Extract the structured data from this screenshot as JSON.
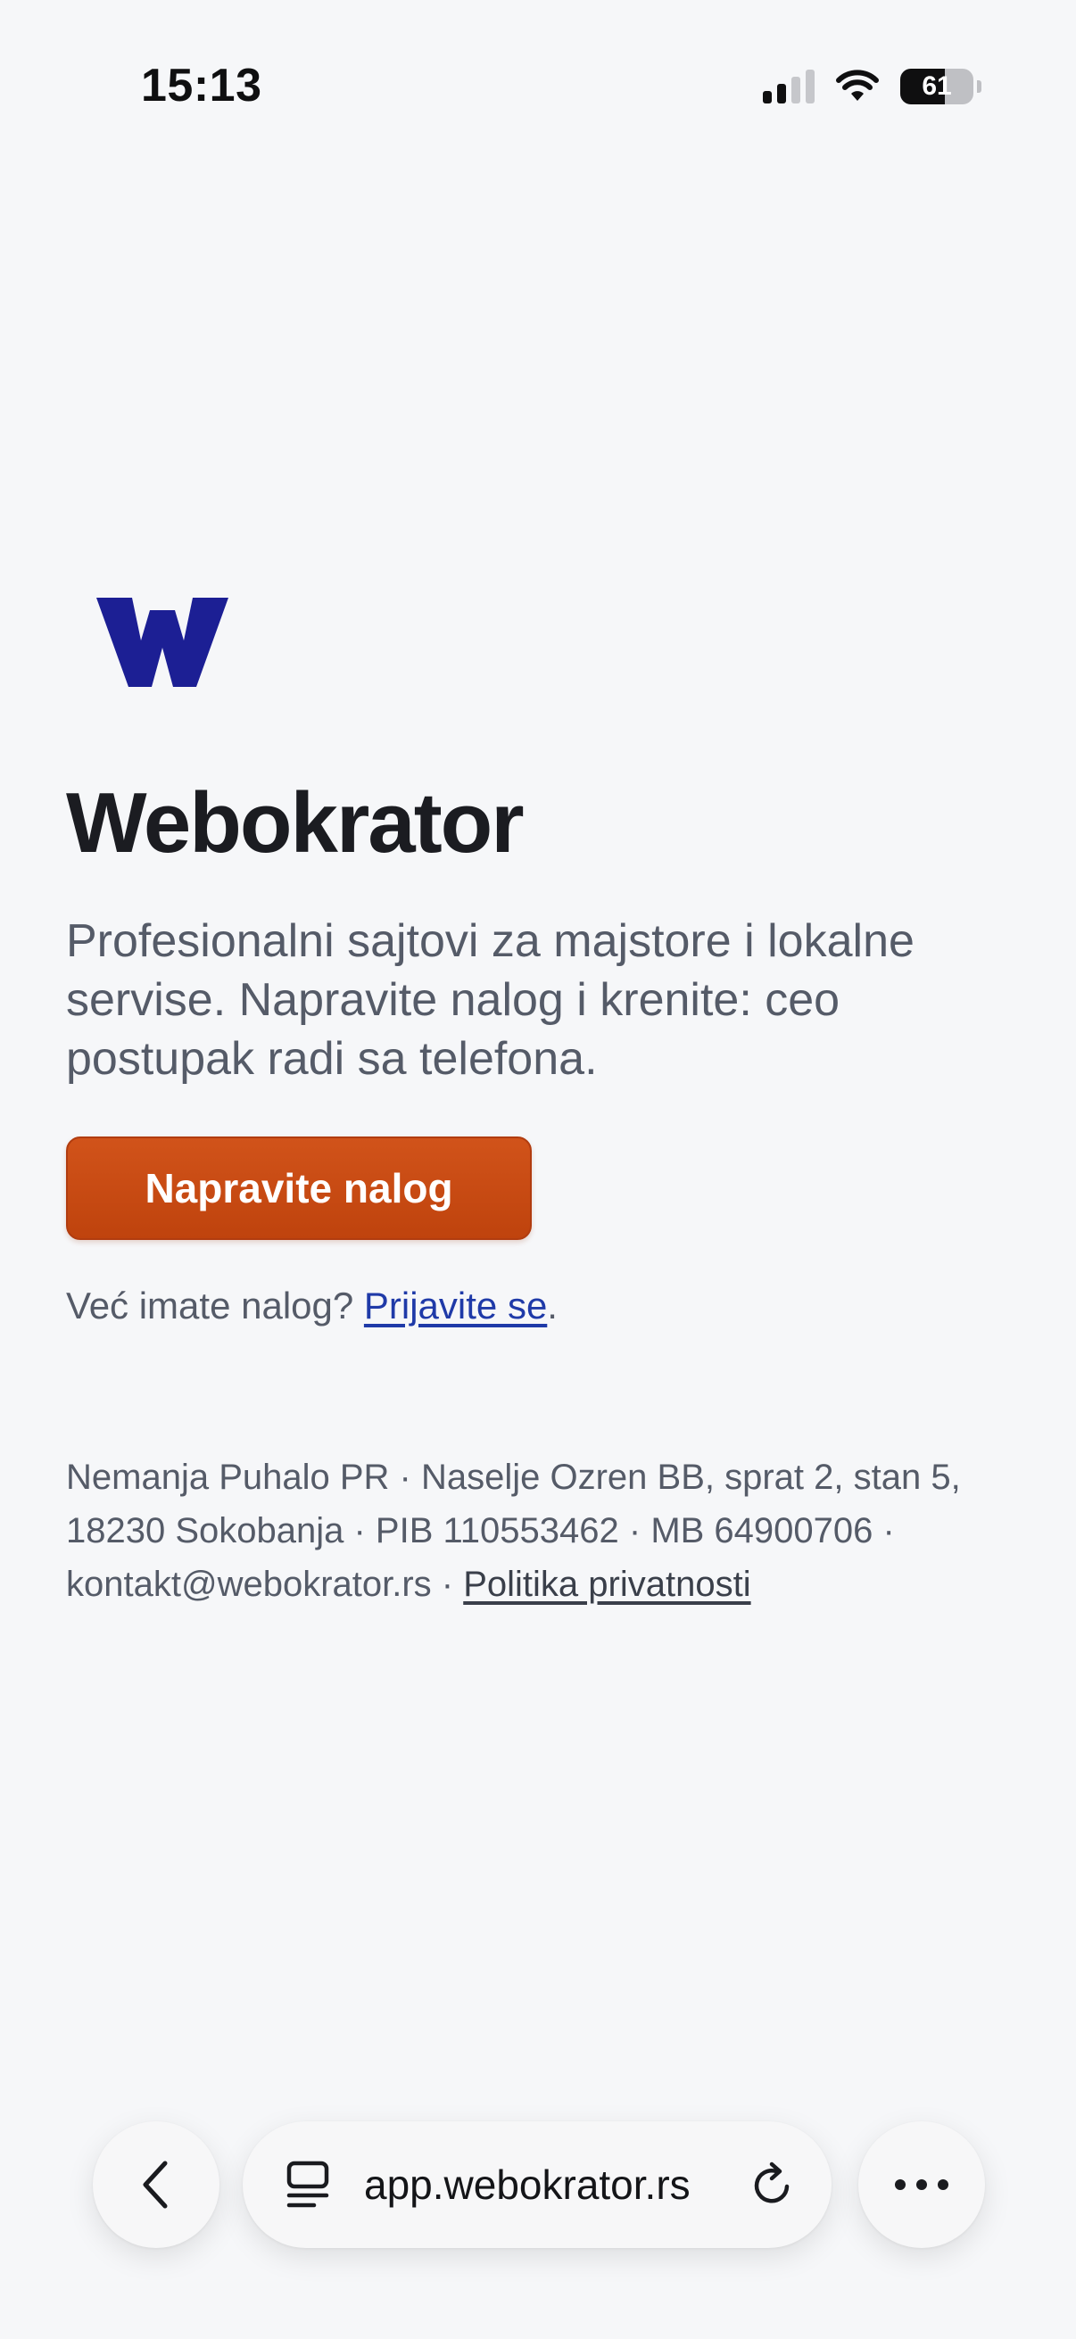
{
  "status_bar": {
    "time": "15:13",
    "battery_level": "61",
    "battery_fraction": 0.61,
    "signal_bars_active": 2,
    "signal_bars_total": 4
  },
  "brand": {
    "logo_icon": "w-logo-icon",
    "logo_color": "#1c1f94",
    "name": "Webokrator"
  },
  "hero": {
    "tagline": "Profesionalni sajtovi za majstore i lokalne servise. Napravite nalog i krenite: ceo postupak radi sa telefona.",
    "cta_label": "Napravite nalog",
    "cta_color": "#c8490f"
  },
  "login": {
    "prompt": "Već imate nalog?",
    "link_label": "Prijavite se",
    "suffix": "."
  },
  "footer": {
    "company_details": "Nemanja Puhalo PR · Naselje Ozren BB, sprat 2, stan 5, 18230 Sokobanja · PIB 110553462 · MB 64900706 · kontakt@webokrator.rs · ",
    "privacy_label": "Politika privatnosti"
  },
  "browser": {
    "url": "app.webokrator.rs",
    "back_icon": "chevron-left-icon",
    "tabs_icon": "tabs-icon",
    "reload_icon": "reload-icon",
    "more_icon": "more-icon"
  }
}
